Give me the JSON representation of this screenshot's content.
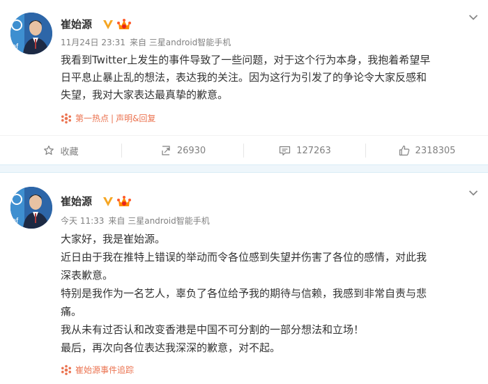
{
  "colors": {
    "accent": "#eb7350",
    "verified": "#f5a623",
    "separator": "#eef6fb",
    "meta": "#808080"
  },
  "posts": [
    {
      "author": "崔始源",
      "time": "11月24日 23:31",
      "source": "来自 三星android智能手机",
      "lines": [
        "我看到Twitter上发生的事件导致了一些问题，对于这个行为本身，我抱着希望早",
        "日平息止暴止乱的想法，表达我的关注。因为这行为引发了的争论令大家反感和",
        "失望，我对大家表达最真挚的歉意。"
      ],
      "topic": {
        "first": "第一热点",
        "bar": "|",
        "second": "声明&回复"
      },
      "actions": {
        "favorite": "收藏",
        "repost": "26930",
        "comment": "127263",
        "like": "2318305"
      }
    },
    {
      "author": "崔始源",
      "time": "今天 11:33",
      "source": "来自 三星android智能手机",
      "lines": [
        "大家好，我是崔始源。",
        "近日由于我在推特上错误的举动而令各位感到失望并伤害了各位的感情，对此我",
        "深表歉意。",
        "特别是我作为一名艺人，辜负了各位给予我的期待与信赖，我感到非常自责与悲",
        "痛。",
        "我从未有过否认和改变香港是中国不可分割的一部分想法和立场！",
        "最后，再次向各位表达我深深的歉意，对不起。"
      ],
      "topic": {
        "first": "崔始源事件追踪"
      }
    }
  ],
  "icons": {
    "verified": "verified-v-icon",
    "member": "vip-crown-icon",
    "more": "chevron-down-icon",
    "topic": "hot-topic-icon",
    "favorite": "star-icon",
    "repost": "repost-icon",
    "comment": "comment-icon",
    "like": "thumbs-up-icon"
  }
}
